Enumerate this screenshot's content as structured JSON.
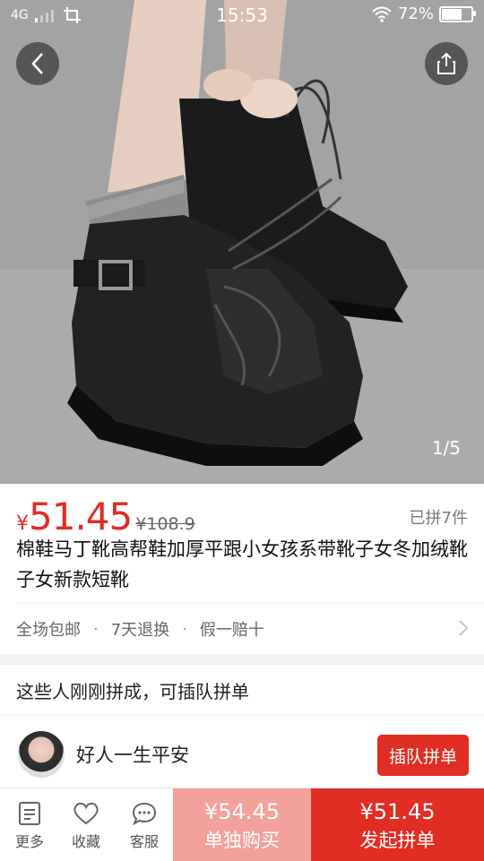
{
  "status_bar": {
    "network": "4G",
    "time": "15:53",
    "battery": "72%",
    "battery_level": 0.72
  },
  "gallery": {
    "counter": "1/5"
  },
  "product": {
    "currency": "¥",
    "price": "51.45",
    "original_price": "¥108.9",
    "sold": "已拼7件",
    "title": "棉鞋马丁靴高帮鞋加厚平跟小女孩系带靴子女冬加绒靴子女新款短靴",
    "services": [
      "全场包邮",
      "7天退换",
      "假一赔十"
    ],
    "service_separator": "·"
  },
  "group_buy": {
    "heading": "这些人刚刚拼成，可插队拼单",
    "user_name": "好人一生平安",
    "join_label": "插队拼单"
  },
  "bottom_bar": {
    "more": "更多",
    "favorite": "收藏",
    "service": "客服",
    "single_price": "¥54.45",
    "single_label": "单独购买",
    "group_price": "¥51.45",
    "group_label": "发起拼单"
  },
  "colors": {
    "accent": "#e02e24",
    "accent_light": "#f3a19b"
  }
}
